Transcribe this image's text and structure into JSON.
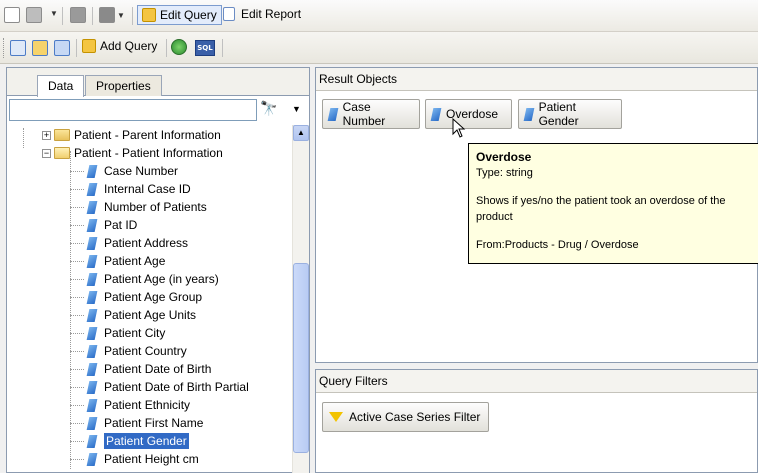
{
  "toolbar_top": {
    "edit_query_label": "Edit Query",
    "edit_report_label": "Edit Report"
  },
  "toolbar_second": {
    "add_query_label": "Add Query",
    "sql_label": "SQL"
  },
  "left_panel": {
    "tabs": [
      {
        "label": "Data"
      },
      {
        "label": "Properties"
      }
    ],
    "search": {
      "value": "",
      "placeholder": ""
    },
    "tree": {
      "folders": [
        {
          "label": "Patient - Parent Information",
          "expanded": false
        },
        {
          "label": "Patient - Patient Information",
          "expanded": true
        }
      ],
      "items": [
        {
          "label": "Case Number"
        },
        {
          "label": "Internal Case ID"
        },
        {
          "label": "Number of Patients"
        },
        {
          "label": "Pat ID"
        },
        {
          "label": "Patient Address"
        },
        {
          "label": "Patient Age"
        },
        {
          "label": "Patient Age (in years)"
        },
        {
          "label": "Patient Age Group"
        },
        {
          "label": "Patient Age Units"
        },
        {
          "label": "Patient City"
        },
        {
          "label": "Patient Country"
        },
        {
          "label": "Patient Date of Birth"
        },
        {
          "label": "Patient Date of Birth Partial"
        },
        {
          "label": "Patient Ethnicity"
        },
        {
          "label": "Patient First Name"
        },
        {
          "label": "Patient Gender",
          "selected": true
        },
        {
          "label": "Patient Height cm"
        }
      ]
    }
  },
  "result_objects": {
    "title": "Result Objects",
    "chips": [
      {
        "label": "Case Number"
      },
      {
        "label": "Overdose"
      },
      {
        "label": "Patient Gender"
      }
    ]
  },
  "tooltip": {
    "title": "Overdose",
    "type_line": "Type: string",
    "description": "Shows if yes/no the patient took an overdose of the product",
    "from_line": "From:Products - Drug / Overdose"
  },
  "query_filters": {
    "title": "Query Filters",
    "filter_label": "Active Case Series Filter"
  },
  "colors": {
    "selection": "#316ac5",
    "tooltip_bg": "#ffffe1",
    "object_blue": "#2a6cc8",
    "filter_yellow": "#f2c300"
  }
}
